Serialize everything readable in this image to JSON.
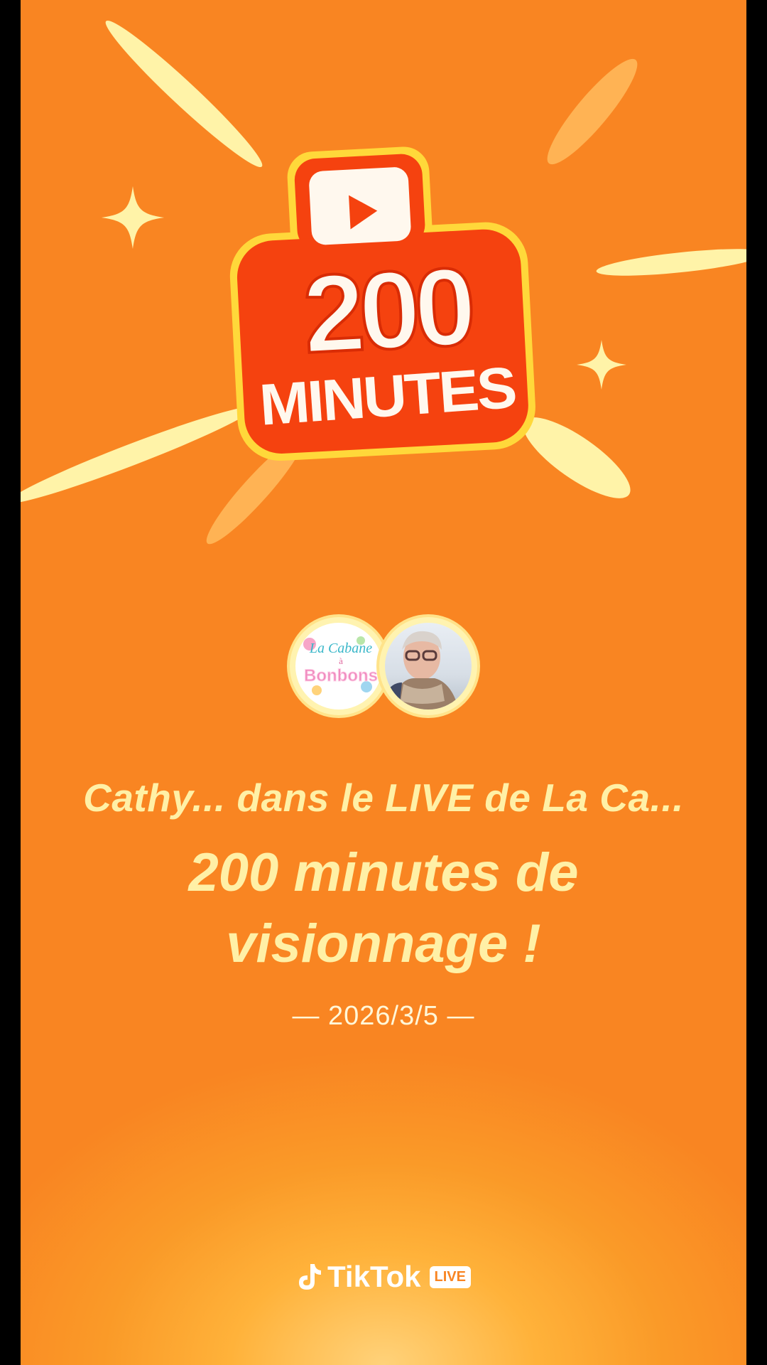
{
  "badge": {
    "number": "200",
    "unit": "MINUTES",
    "icon": "play-icon"
  },
  "avatars": [
    {
      "name": "shop-logo-avatar",
      "logo_line1": "La Cabane",
      "logo_line2": "à",
      "logo_line3": "Bonbons"
    },
    {
      "name": "user-avatar"
    }
  ],
  "headline": {
    "line1": "Cathy... dans le LIVE de La Ca...",
    "line2": "200 minutes de",
    "line3": "visionnage !"
  },
  "date": "— 2026/3/5 —",
  "brand": {
    "name": "TikTok",
    "live": "LIVE",
    "icon": "tiktok-note-icon"
  },
  "colors": {
    "background": "#f98522",
    "accent_yellow": "#fff0a6",
    "badge_red": "#f5420f",
    "badge_border": "#ffd83a"
  }
}
